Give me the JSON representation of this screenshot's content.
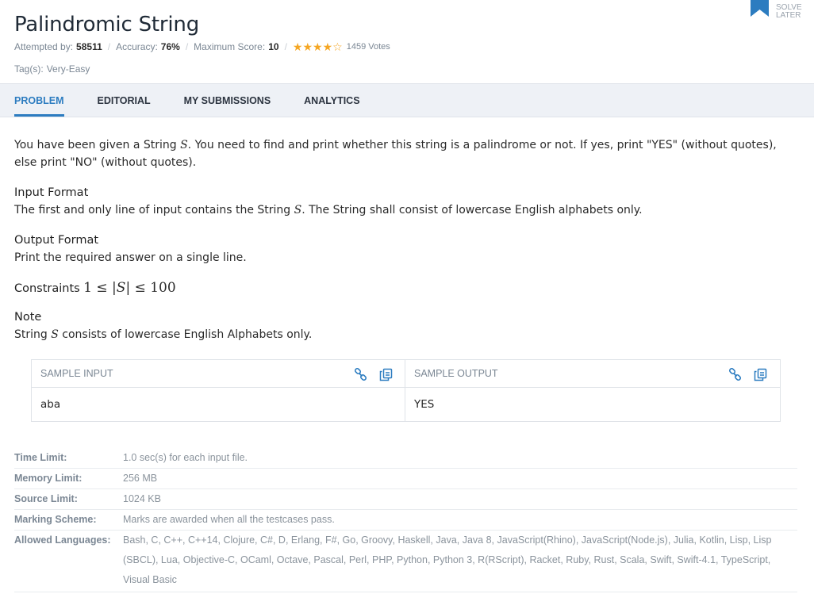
{
  "problem": {
    "title": "Palindromic String",
    "attempted_label": "Attempted by:",
    "attempted_value": "58511",
    "accuracy_label": "Accuracy:",
    "accuracy_value": "76%",
    "max_score_label": "Maximum Score:",
    "max_score_value": "10",
    "rating": 4,
    "rating_max": 5,
    "votes": "1459 Votes",
    "tags_label": "Tag(s):",
    "tags_value": "Very-Easy"
  },
  "solve_later": {
    "line1": "SOLVE",
    "line2": "LATER",
    "icon": "bookmark-icon"
  },
  "tabs": [
    {
      "label": "PROBLEM",
      "active": true
    },
    {
      "label": "EDITORIAL",
      "active": false
    },
    {
      "label": "MY SUBMISSIONS",
      "active": false
    },
    {
      "label": "ANALYTICS",
      "active": false
    }
  ],
  "statement": {
    "intro_1": "You have been given a String ",
    "intro_var": "S",
    "intro_2": ". You need to find and print whether this string is a palindrome or not. If yes, print \"YES\" (without quotes), else print \"NO\" (without quotes).",
    "input_title": "Input Format",
    "input_1": "The first and only line of input contains the String ",
    "input_var": "S",
    "input_2": ". The String shall consist of lowercase English alphabets only.",
    "output_title": "Output Format",
    "output_text": "Print the required answer on a single line.",
    "constraints_title": "Constraints",
    "constraints_math_1": "1 ≤ |",
    "constraints_math_var": "S",
    "constraints_math_2": "| ≤ 100",
    "note_title": "Note",
    "note_1": "String ",
    "note_var": "S",
    "note_2": " consists of lowercase English Alphabets only."
  },
  "sample": {
    "input_header": "SAMPLE INPUT",
    "output_header": "SAMPLE OUTPUT",
    "input_value": "aba",
    "output_value": "YES"
  },
  "limits": [
    {
      "key": "Time Limit:",
      "value": "1.0 sec(s) for each input file."
    },
    {
      "key": "Memory Limit:",
      "value": "256 MB"
    },
    {
      "key": "Source Limit:",
      "value": "1024 KB"
    },
    {
      "key": "Marking Scheme:",
      "value": "Marks are awarded when all the testcases pass."
    },
    {
      "key": "Allowed Languages:",
      "value": "Bash, C, C++, C++14, Clojure, C#, D, Erlang, F#, Go, Groovy, Haskell, Java, Java 8, JavaScript(Rhino), JavaScript(Node.js), Julia, Kotlin, Lisp, Lisp (SBCL), Lua, Objective-C, OCaml, Octave, Pascal, Perl, PHP, Python, Python 3, R(RScript), Racket, Ruby, Rust, Scala, Swift, Swift-4.1, TypeScript, Visual Basic"
    }
  ],
  "colors": {
    "accent": "#2c7cc0",
    "star": "#f5a623",
    "tab_bar": "#eef1f6",
    "muted_text": "#7b8794"
  }
}
